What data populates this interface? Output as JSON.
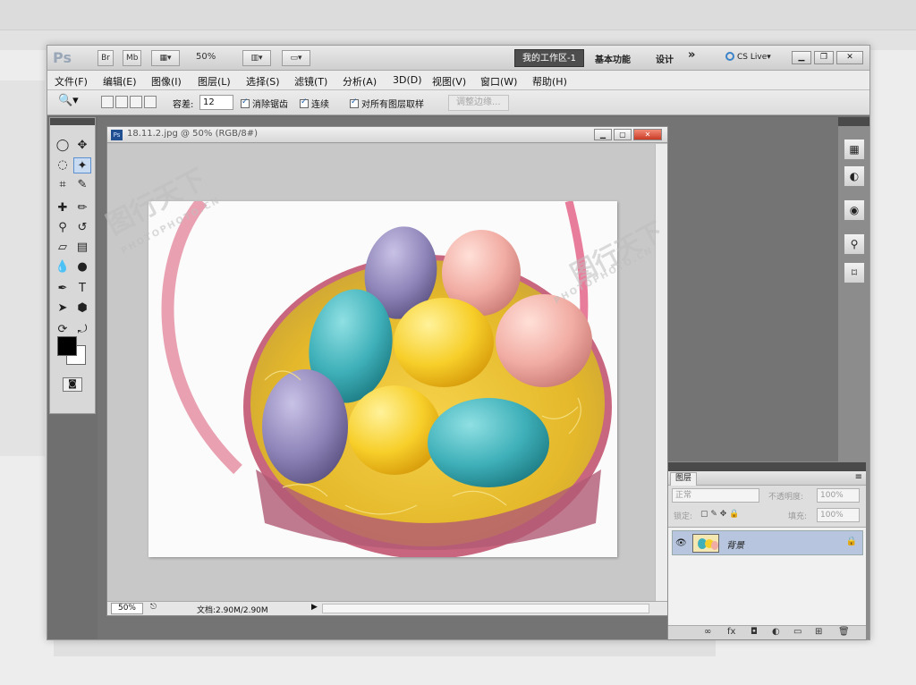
{
  "app": {
    "logo": "Ps",
    "bridge_label": "Br",
    "minibridge_label": "Mb",
    "zoom": "50%",
    "workspace_active": "我的工作区-1",
    "workspace_items": [
      "基本功能",
      "设计"
    ],
    "more_label": "»",
    "cs_live": "CS Live▾"
  },
  "menubar": [
    "文件(F)",
    "编辑(E)",
    "图像(I)",
    "图层(L)",
    "选择(S)",
    "滤镜(T)",
    "分析(A)",
    "3D(D)",
    "视图(V)",
    "窗口(W)",
    "帮助(H)"
  ],
  "options": {
    "tolerance_label": "容差:",
    "tolerance_value": "12",
    "anti_alias": "消除锯齿",
    "contiguous": "连续",
    "sample_all": "对所有图层取样",
    "refine_edge": "调整边缘..."
  },
  "document": {
    "title": "18.11.2.jpg @ 50% (RGB/8#)",
    "zoom": "50%",
    "doc_info": "文档:2.90M/2.90M"
  },
  "layers_panel": {
    "tab": "图层",
    "blend_mode": "正常",
    "opacity_label": "不透明度:",
    "opacity_value": "100%",
    "lock_label": "锁定:",
    "fill_label": "填充:",
    "fill_value": "100%",
    "layer_name": "背景"
  },
  "watermark": {
    "text": "图行天下",
    "sub": "PHOTOPHOTO.CN"
  },
  "colors": {
    "accent": "#3a83c9",
    "selected_layer": "#b7c6de",
    "foreground": "#000000",
    "background": "#ffffff"
  }
}
